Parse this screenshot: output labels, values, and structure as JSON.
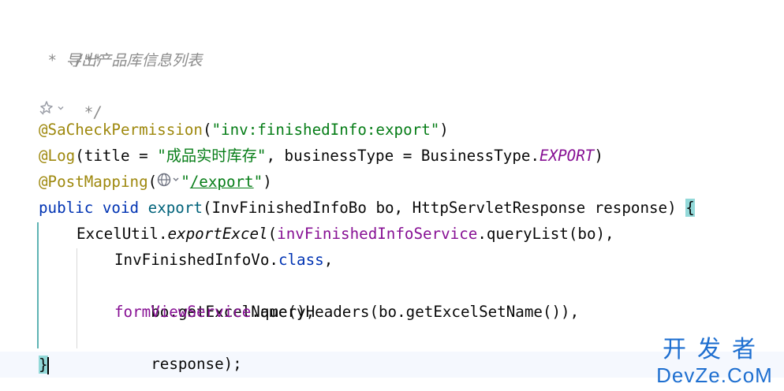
{
  "code": {
    "doc_open": "/**",
    "doc_star": " * ",
    "doc_text": "导出产品库信息列表",
    "doc_close": " */",
    "ann1_name": "@SaCheckPermission",
    "ann1_open": "(",
    "ann1_value": "\"inv:finishedInfo:export\"",
    "ann1_close": ")",
    "ann2_name": "@Log",
    "ann2_part1": "(title = ",
    "ann2_q1": "\"",
    "ann2_title": "成品实时库存",
    "ann2_q2": "\"",
    "ann2_part2": ", businessType = BusinessType.",
    "ann2_enum": "EXPORT",
    "ann2_close": ")",
    "ann3_name": "@PostMapping",
    "ann3_open": "(",
    "ann3_q1": "\"",
    "ann3_path": "/export",
    "ann3_q2": "\"",
    "ann3_close": ")",
    "sig_public": "public",
    "sig_void": "void",
    "sig_name": "export",
    "sig_params": "(InvFinishedInfoBo bo, HttpServletResponse response) ",
    "sig_brace": "{",
    "l1_class": "ExcelUtil.",
    "l1_method": "exportExcel",
    "l1_open": "(",
    "l1_field": "invFinishedInfoService",
    "l1_rest": ".queryList(bo),",
    "l2_type": "InvFinishedInfoVo.",
    "l2_class_kw": "class",
    "l2_comma": ",",
    "l3_text": "bo.getExcelName(),",
    "l4_field": "formViewService",
    "l4_rest": ".queryHeaders(bo.getExcelSetName()),",
    "l5_text": "response);",
    "close_brace": "}"
  },
  "icons": {
    "hint_icon": "ai-assist-icon",
    "hint_chevron": "chevron-down-icon",
    "globe": "globe-icon"
  },
  "watermark": {
    "line1": "开发者",
    "line2": "DevZe.CoM"
  },
  "colors": {
    "comment": "#8c8c8c",
    "annotation": "#9e880d",
    "string": "#067d17",
    "keyword": "#0033b3",
    "method": "#00627a",
    "field": "#871094",
    "brace_match": "#93d9d9",
    "watermark": "#1e6fd0"
  }
}
